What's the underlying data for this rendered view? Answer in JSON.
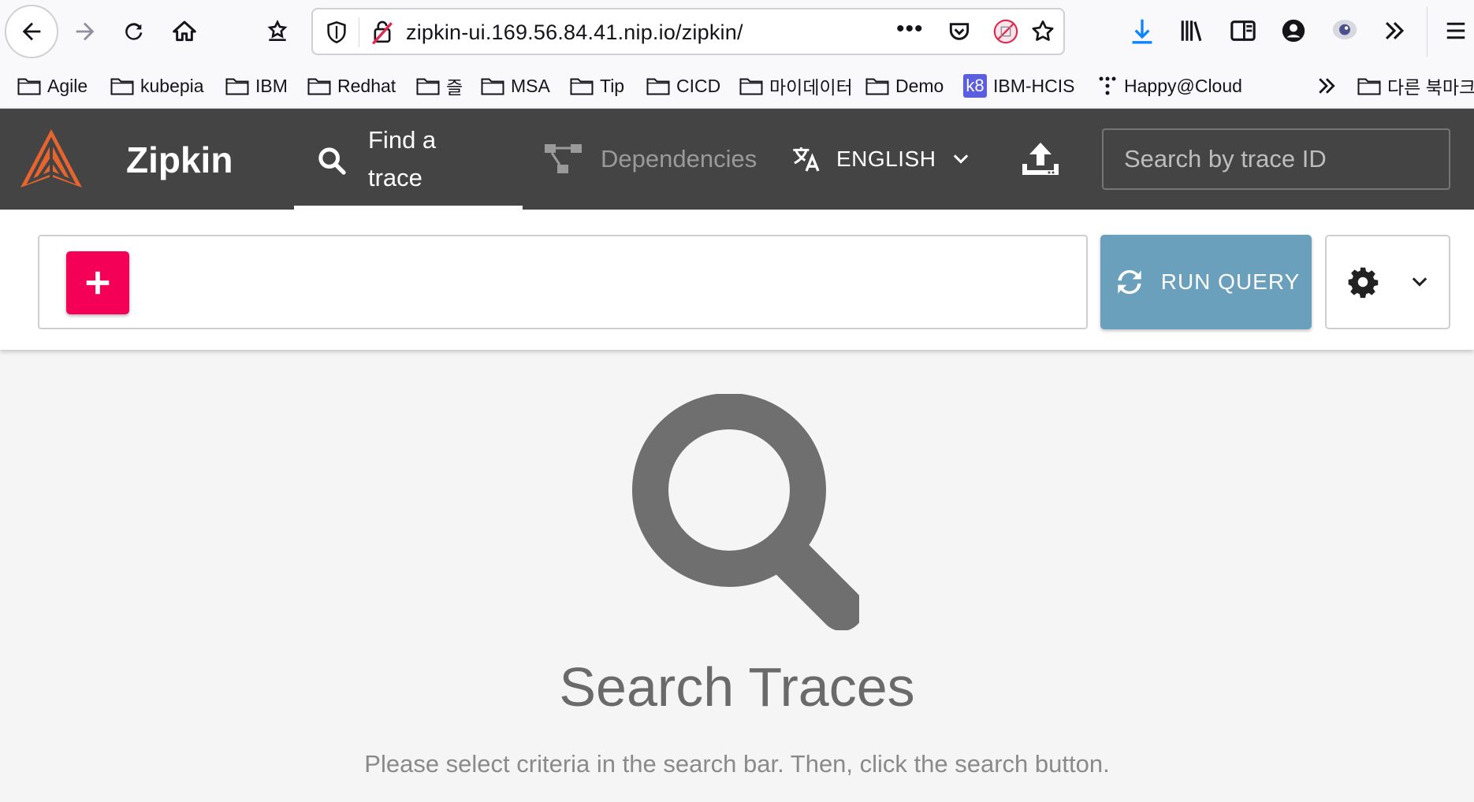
{
  "browser": {
    "url": "zipkin-ui.169.56.84.41.nip.io/zipkin/",
    "bookmarks": [
      {
        "label": "Agile",
        "icon": "folder-icon"
      },
      {
        "label": "kubepia",
        "icon": "folder-icon"
      },
      {
        "label": "IBM",
        "icon": "folder-icon"
      },
      {
        "label": "Redhat",
        "icon": "folder-icon"
      },
      {
        "label": "즐",
        "icon": "folder-icon"
      },
      {
        "label": "MSA",
        "icon": "folder-icon"
      },
      {
        "label": "Tip",
        "icon": "folder-icon"
      },
      {
        "label": "CICD",
        "icon": "folder-icon"
      },
      {
        "label": "마이데이터",
        "icon": "folder-icon"
      },
      {
        "label": "Demo",
        "icon": "folder-icon"
      },
      {
        "label": "IBM-HCIS",
        "icon": "k8-icon"
      },
      {
        "label": "Happy@Cloud",
        "icon": "dots-icon"
      }
    ],
    "other_bookmarks": "다른 북마크",
    "k8_badge": "k8"
  },
  "header": {
    "app_title": "Zipkin",
    "tab_find": "Find a trace",
    "tab_dependencies": "Dependencies",
    "language": "ENGLISH",
    "trace_search_placeholder": "Search by trace ID",
    "brand_color": "#e6642d"
  },
  "query": {
    "run_label": "RUN QUERY",
    "add_color": "#f50057",
    "run_color": "#6aa0bb"
  },
  "empty_state": {
    "title": "Search Traces",
    "subtitle": "Please select criteria in the search bar. Then, click the search button."
  }
}
